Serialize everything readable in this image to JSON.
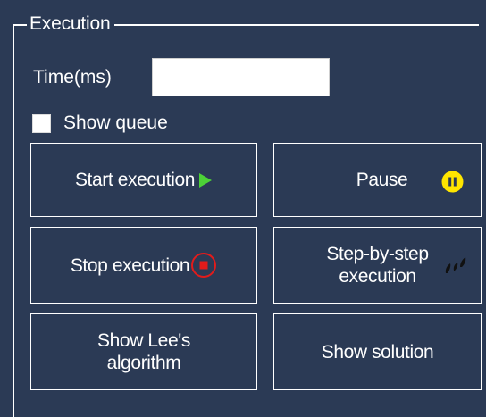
{
  "execution_group": {
    "title": "Execution",
    "time_label": "Time(ms)",
    "time_value": "",
    "show_queue_label": "Show queue",
    "show_queue_checked": false
  },
  "buttons": {
    "start": {
      "label": "Start execution",
      "icon": "play-icon",
      "icon_color": "#4cd137"
    },
    "pause": {
      "label": "Pause",
      "icon": "pause-icon",
      "icon_color": "#ffe600"
    },
    "stop": {
      "label": "Stop execution",
      "icon": "stop-icon",
      "icon_color": "#e21b1b"
    },
    "step": {
      "label_line1": "Step-by-step",
      "label_line2": "execution",
      "icon": "footsteps-icon",
      "icon_color": "#111111"
    },
    "lee": {
      "label_line1": "Show Lee's",
      "label_line2": "algorithm"
    },
    "solution": {
      "label": "Show solution"
    }
  },
  "colors": {
    "background": "#2b3a55",
    "foreground": "#ffffff"
  }
}
